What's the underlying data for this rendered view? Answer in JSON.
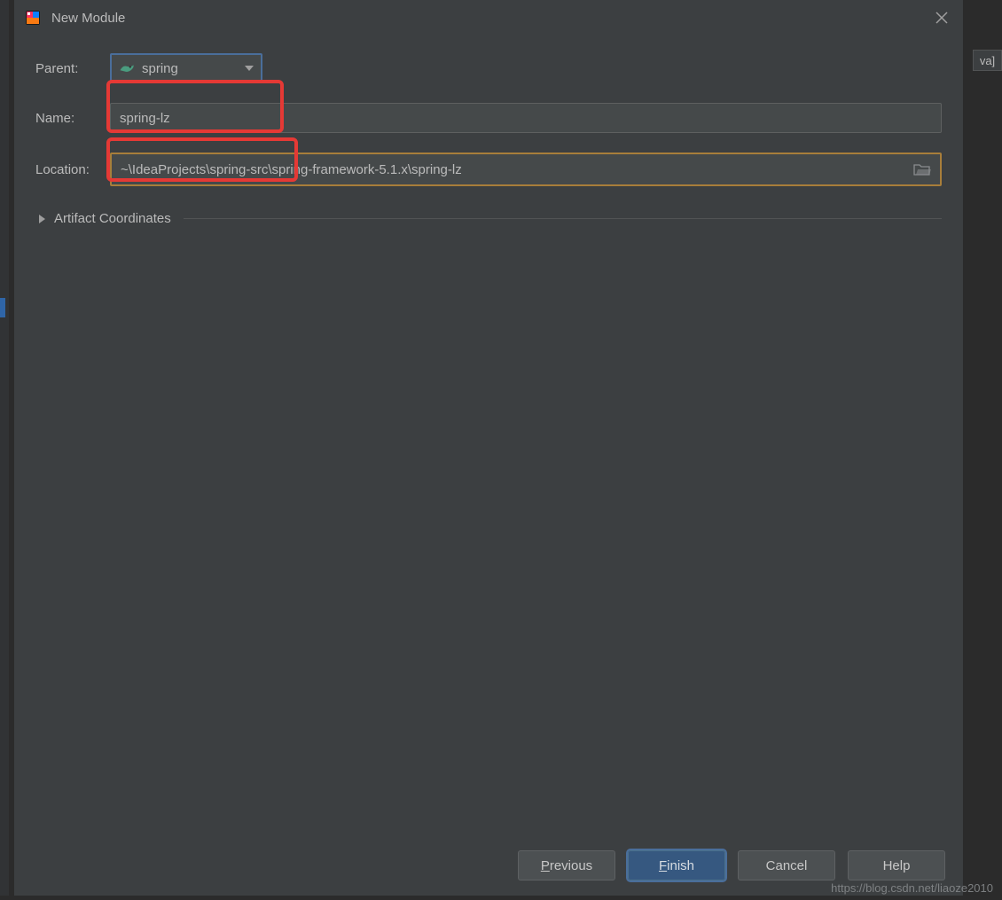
{
  "dialog": {
    "title": "New Module",
    "parent_label": "Parent:",
    "parent_value": "spring",
    "name_label": "Name:",
    "name_value": "spring-lz",
    "location_label": "Location:",
    "location_value": "~\\IdeaProjects\\spring-src\\spring-framework-5.1.x\\spring-lz",
    "artifact_coords": "Artifact Coordinates"
  },
  "buttons": {
    "previous_mnemonic": "P",
    "previous_rest": "revious",
    "finish_mnemonic": "F",
    "finish_rest": "inish",
    "cancel": "Cancel",
    "help": "Help"
  },
  "background": {
    "right_tab": "va]"
  },
  "watermark": "https://blog.csdn.net/liaoze2010"
}
